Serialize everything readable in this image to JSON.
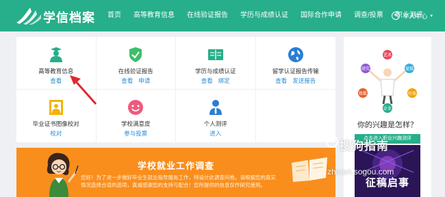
{
  "header": {
    "brand": "学信档案",
    "nav": [
      "首页",
      "高等教育信息",
      "在线验证报告",
      "学历与成绩认证",
      "国际合作申请",
      "调查/投票",
      "职业测评"
    ],
    "user_menu": "个人中心"
  },
  "services": [
    {
      "title": "高等教育信息",
      "links": [
        "查看"
      ],
      "icon": "graduate-icon"
    },
    {
      "title": "在线验证报告",
      "links": [
        "查看",
        "申请"
      ],
      "icon": "shield-check-icon"
    },
    {
      "title": "学历与成绩认证",
      "links": [
        "查看",
        "绑定"
      ],
      "icon": "book-icon"
    },
    {
      "title": "留学认证报告传输",
      "links": [
        "查看",
        "发送报告"
      ],
      "icon": "globe-icon"
    },
    {
      "title": "毕业证书图像校对",
      "links": [
        "校对"
      ],
      "icon": "id-photo-icon"
    },
    {
      "title": "学校满意度",
      "links": [
        "参与投票"
      ],
      "icon": "smile-icon"
    },
    {
      "title": "个人测评",
      "links": [
        "进入"
      ],
      "icon": "person-icon"
    }
  ],
  "banner": {
    "title": "学校就业工作调查",
    "text": "您好！为了进一步做好毕业生就业指导服务工作，特设计此调查问卷。请根据您的真实情况选择合适的选项，真诚感谢您的支持与配合！您所提供的信息仅作研究使用。"
  },
  "side": {
    "question": "你的兴趣是怎样？",
    "enter_button": "点击进入职业兴趣测评",
    "promo_text": "征稿启事",
    "interest_labels": [
      "研究",
      "艺术",
      "常规",
      "社会",
      "企业",
      "技能"
    ]
  },
  "watermark": {
    "title": "搜狗指南",
    "url": "zhinan.sogou.com"
  },
  "colors": {
    "brand": "#27ae8a",
    "link": "#2a8ed6",
    "banner": "#f98e1d",
    "arrow": "#e0292d"
  }
}
